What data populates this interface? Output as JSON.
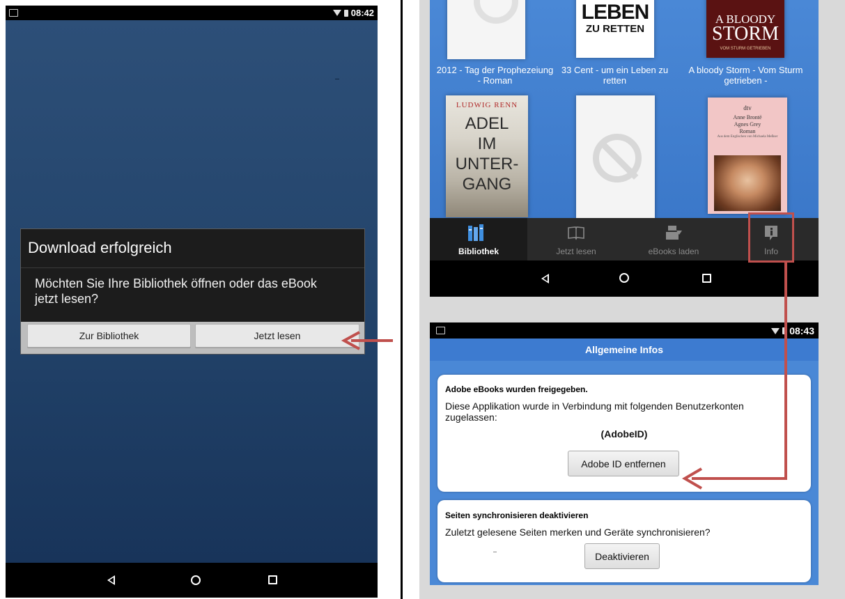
{
  "left_phone": {
    "status_time": "08:42",
    "dialog": {
      "title": "Download erfolgreich",
      "message": "Möchten Sie Ihre Bibliothek öffnen oder das eBook jetzt lesen?",
      "btn_library": "Zur Bibliothek",
      "btn_read_now": "Jetzt lesen"
    }
  },
  "library": {
    "books": [
      {
        "caption": "2012 - Tag der Prophezeiung - Roman"
      },
      {
        "caption": "33 Cent - um ein Leben zu retten",
        "cover_line1": "LEBEN",
        "cover_line2": "ZU RETTEN"
      },
      {
        "caption": "A bloody Storm - Vom Sturm getrieben -",
        "cover_line1": "A BLOODY",
        "cover_line2": "STORM",
        "cover_line3": "VOM STURM GETRIEBEN"
      },
      {
        "caption": "",
        "cover_author": "LUDWIG RENN",
        "cover_line1": "ADEL",
        "cover_line2": "IM",
        "cover_line3": "UNTER-",
        "cover_line4": "GANG"
      },
      {
        "caption": ""
      },
      {
        "caption": "",
        "cover_pub": "dtv",
        "cover_author": "Anne Brontë",
        "cover_title": "Agnes Grey",
        "cover_sub": "Roman",
        "cover_note": "Aus dem Englischen von Michaela Meßner"
      }
    ],
    "tabs": [
      {
        "label": "Bibliothek",
        "icon": "books-icon",
        "active": true
      },
      {
        "label": "Jetzt lesen",
        "icon": "open-book-icon",
        "active": false
      },
      {
        "label": "eBooks laden",
        "icon": "download-books-icon",
        "active": false
      },
      {
        "label": "Info",
        "icon": "info-icon",
        "active": false
      }
    ]
  },
  "info_screen": {
    "status_time": "08:43",
    "header": "Allgemeine Infos",
    "card1": {
      "title": "Adobe eBooks wurden freigegeben.",
      "text": "Diese Applikation wurde in Verbindung mit folgenden Benutzerkonten zugelassen:",
      "account": "(AdobeID)",
      "button": "Adobe ID entfernen"
    },
    "card2": {
      "title": "Seiten synchronisieren deaktivieren",
      "text": "Zuletzt gelesene Seiten merken und Geräte synchronisieren?",
      "button": "Deaktivieren"
    }
  },
  "colors": {
    "annotation_red": "#c0504d",
    "library_blue": "#4a88d6",
    "active_tab_bg": "#1b1b1b"
  }
}
